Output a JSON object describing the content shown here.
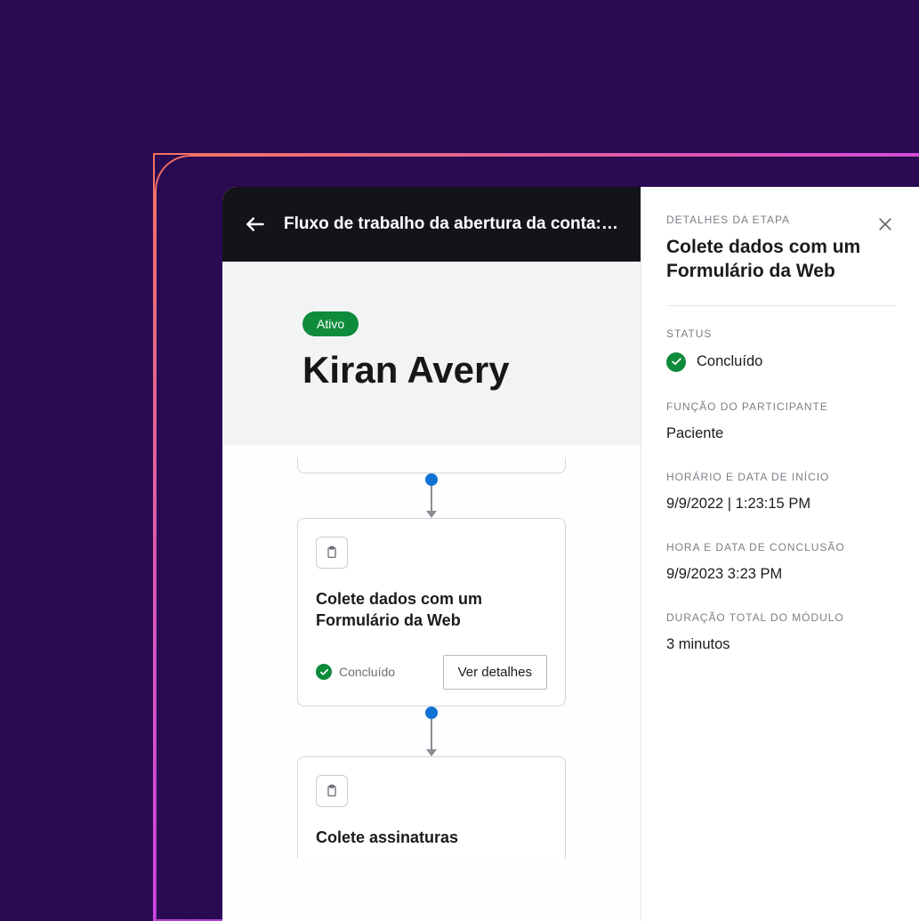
{
  "header": {
    "title": "Fluxo de trabalho da abertura da conta: K..."
  },
  "hero": {
    "status_pill": "Ativo",
    "name": "Kiran Avery"
  },
  "flow": {
    "card1": {
      "title": "Colete dados com um Formulário da Web",
      "status_label": "Concluído",
      "button_label": "Ver detalhes"
    },
    "card2": {
      "title": "Colete assinaturas"
    }
  },
  "panel": {
    "eyebrow": "DETALHES DA ETAPA",
    "title": "Colete dados com um Formulário da Web",
    "status_label_heading": "STATUS",
    "status_value": "Concluído",
    "role_label": "FUNÇÃO DO PARTICIPANTE",
    "role_value": "Paciente",
    "start_label": "HORÁRIO E DATA DE INÍCIO",
    "start_value": "9/9/2022 | 1:23:15 PM",
    "end_label": "HORA E DATA DE CONCLUSÃO",
    "end_value": "9/9/2023 3:23 PM",
    "duration_label": "DURAÇÃO TOTAL DO MÓDULO",
    "duration_value": "3 minutos"
  }
}
